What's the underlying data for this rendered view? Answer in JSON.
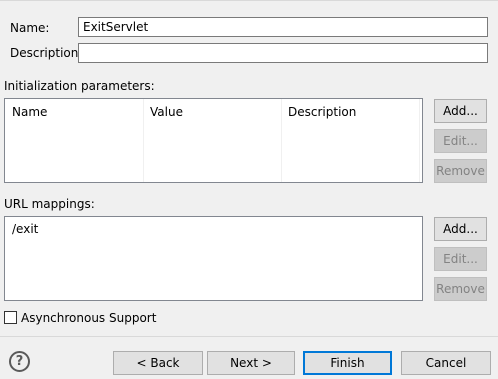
{
  "form": {
    "name_label": "Name:",
    "name_value": "ExitServlet",
    "description_label": "Description:",
    "description_value": ""
  },
  "init_params": {
    "title": "Initialization parameters:",
    "columns": [
      "Name",
      "Value",
      "Description"
    ],
    "buttons": {
      "add": "Add...",
      "edit": "Edit...",
      "remove": "Remove"
    }
  },
  "url_mappings": {
    "title": "URL mappings:",
    "items": [
      "/exit"
    ],
    "buttons": {
      "add": "Add...",
      "edit": "Edit...",
      "remove": "Remove"
    }
  },
  "async": {
    "label": "Asynchronous Support",
    "checked": false
  },
  "footer": {
    "help_icon": "help-icon",
    "back": "< Back",
    "next": "Next >",
    "finish": "Finish",
    "cancel": "Cancel"
  },
  "colors": {
    "accent": "#0078d7",
    "background": "#f0f0f0"
  }
}
